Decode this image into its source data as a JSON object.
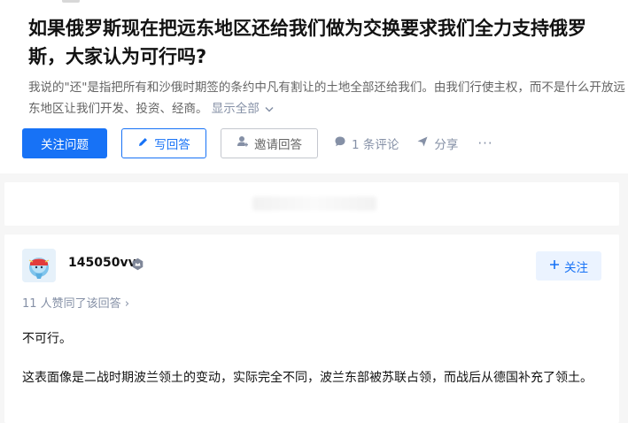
{
  "question": {
    "title": "如果俄罗斯现在把远东地区还给我们做为交换要求我们全力支持俄罗斯，大家认为可行吗?",
    "detail": "我说的\"还\"是指把所有和沙俄时期签的条约中凡有割让的土地全部还给我们。由我们行使主权，而不是什么开放远东地区让我们开发、投资、经商。",
    "show_all_label": "显示全部"
  },
  "actions": {
    "follow_label": "关注问题",
    "write_answer_label": "写回答",
    "invite_label": "邀请回答",
    "comments_label": "1 条评论",
    "share_label": "分享",
    "more_label": "···"
  },
  "answer": {
    "author_name": "145050vv",
    "follow_label": "关注",
    "votes_text": "11 人赞同了该回答",
    "votes_arrow": "›",
    "paragraphs": [
      "不可行。",
      "这表面像是二战时期波兰领土的变动，实际完全不同，波兰东部被苏联占领，而战后从德国补充了领土。"
    ]
  },
  "colors": {
    "brand_blue": "#1772f6",
    "meta_gray": "#8590a6",
    "page_bg": "#f6f6f6"
  }
}
